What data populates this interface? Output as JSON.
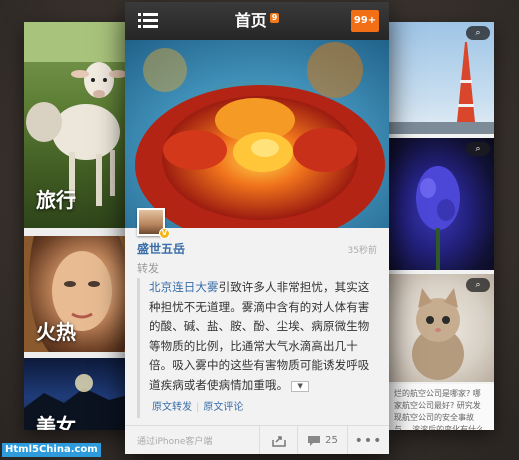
{
  "left_panel": {
    "tiles": [
      {
        "label": "旅行"
      },
      {
        "label": "火热"
      },
      {
        "label": "美女"
      }
    ]
  },
  "right_panel": {
    "zoom_icon": "zoom-icon",
    "snippet": "烂的航空公司是哪家? 哪家航空公司最好? 研究发现航空公司的安全事故与... 滚滚后的变化有什么进行什么"
  },
  "header": {
    "menu_icon": "hamburger-menu-icon",
    "title": "首页",
    "title_badge": "9",
    "notify_count": "99+"
  },
  "post": {
    "author": "盛世五岳",
    "time": "35秒前",
    "repost_label": "转发",
    "verify_badge": "V",
    "quoted": {
      "mention": "北京连日大雾",
      "text": "引致许多人非常担忧，其实这种担忧不无道理。雾滴中含有的对人体有害的酸、碱、盐、胺、酚、尘埃、病原微生物等物质的比例，比通常大气水滴高出几十倍。吸入雾中的这些有害物质可能诱发呼吸道疾病或者使病情加重哦。",
      "expand_icon": "expand-arrow-icon",
      "link_repost": "原文转发",
      "link_comment": "原文评论"
    },
    "client": "通过iPhone客户端",
    "comment_count": "25"
  },
  "watermark": "Html5China.com",
  "colors": {
    "accent": "#f36f15",
    "link": "#3a6ea8",
    "topbar": "#2b2b2b"
  }
}
